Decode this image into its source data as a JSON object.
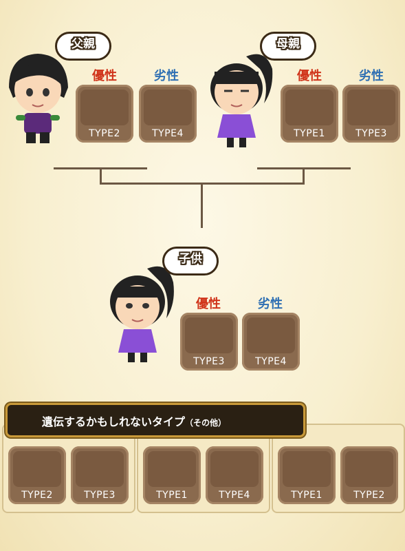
{
  "father": {
    "label": "父親",
    "dominant_label": "優性",
    "recessive_label": "劣性",
    "dominant_type": "TYPE2",
    "recessive_type": "TYPE4"
  },
  "mother": {
    "label": "母親",
    "dominant_label": "優性",
    "recessive_label": "劣性",
    "dominant_type": "TYPE1",
    "recessive_type": "TYPE3"
  },
  "child": {
    "label": "子供",
    "dominant_label": "優性",
    "recessive_label": "劣性",
    "dominant_type": "TYPE3",
    "recessive_type": "TYPE4"
  },
  "banner": {
    "title": "遺伝するかもしれないタイプ",
    "note": "（その他）"
  },
  "other_types": [
    [
      "TYPE2",
      "TYPE3"
    ],
    [
      "TYPE1",
      "TYPE4"
    ],
    [
      "TYPE1",
      "TYPE2"
    ]
  ],
  "colors": {
    "dominant": "#d0341a",
    "recessive": "#2e6fb3",
    "tile": "#8a6a4e"
  }
}
